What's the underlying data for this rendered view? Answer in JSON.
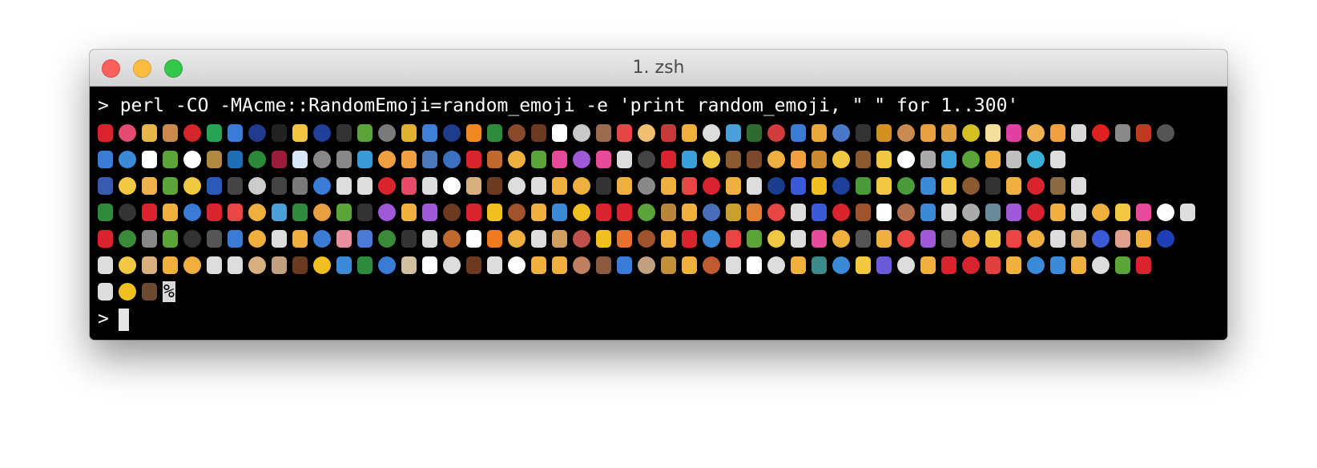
{
  "window": {
    "title": "1. zsh"
  },
  "terminal": {
    "command_line": "> perl -CO -MAcme::RandomEmoji=random_emoji -e 'print random_emoji, \" \" for 1..300'",
    "end_marker": "%",
    "prompt": ">"
  },
  "colors": {
    "background": "#000000",
    "text": "#ffffff",
    "titlebar": "#dcdcdc",
    "close": "#fc605c",
    "minimize": "#fdbc40",
    "maximize": "#34c84a"
  },
  "emoji_rows": [
    [
      "#d9232e",
      "#e34a6f",
      "#e8b64a",
      "#c98a4b",
      "#d6262b",
      "#27a355",
      "#3b7bd8",
      "#203a8c",
      "#222222",
      "#f4c542",
      "#1f3f9b",
      "#333333",
      "#5aa43a",
      "#7a7a7a",
      "#e0b030",
      "#3f7fd8",
      "#1e3c8a",
      "#f08a20",
      "#2e8b3d",
      "#8a4a2a",
      "#6b3a20",
      "#ffffff",
      "#c9c9c9",
      "#9a6b4f",
      "#e54545",
      "#f0c070",
      "#c83a3a",
      "#f0b040",
      "#dddddd",
      "#4aa0d8",
      "#2f6b2f",
      "#d23b3b",
      "#3a7bd5",
      "#e8a83c",
      "#4a78c8",
      "#333333",
      "#d29020",
      "#c88a50",
      "#e8a040",
      "#e0a040",
      "#d4c020",
      "#f2e09a",
      "#e040a0",
      "#f0b050",
      "#f0a040",
      "#d8d8d8",
      "#e02020",
      "#8a8a8a",
      "#c03a20",
      "#555555"
    ],
    [
      "#3a7bd5",
      "#3a8ad8",
      "#ffffff",
      "#5aa43a",
      "#ffffff",
      "#b08a40",
      "#1f6fb8",
      "#2a8a3a",
      "#9a1b3a",
      "#d8e8f8",
      "#888888",
      "#888888",
      "#3a9ad8",
      "#f0a040",
      "#f0a040",
      "#4a78b8",
      "#3a70c0",
      "#d9232e",
      "#c06a30",
      "#f0b040",
      "#5aa43a",
      "#e84a9a",
      "#a05ad8",
      "#e84a9a",
      "#dddddd",
      "#444444",
      "#d9232e",
      "#3aa0d8",
      "#f0c842",
      "#8a5a30",
      "#7a4a2a",
      "#f0b040",
      "#f0a040",
      "#cc8a30",
      "#f0c842",
      "#8a5a30",
      "#f0c842",
      "#ffffff",
      "#aaaaaa",
      "#3aa0d8",
      "#5aa43a",
      "#f0b040",
      "#c0c0c0",
      "#3ab0d8",
      "#dddddd"
    ],
    [
      "#3a5ab0",
      "#f0c842",
      "#f0b050",
      "#5aa43a",
      "#f0c842",
      "#2a5ab8",
      "#444444",
      "#cccccc",
      "#444444",
      "#7a7a7a",
      "#3a7bd5",
      "#dddddd",
      "#dddddd",
      "#d9232e",
      "#e84a6a",
      "#dddddd",
      "#ffffff",
      "#d8b080",
      "#6b3a20",
      "#dddddd",
      "#dddddd",
      "#f0b040",
      "#f0b040",
      "#333333",
      "#f0b040",
      "#888888",
      "#f0b040",
      "#e84545",
      "#d9232e",
      "#f0b040",
      "#dddddd",
      "#1a3c8a",
      "#3a5ad8",
      "#f0c020",
      "#1f3f9b",
      "#4a9a3a",
      "#f0c842",
      "#4a9a3a",
      "#3a8ad8",
      "#f0c842",
      "#8a5a30",
      "#333333",
      "#f0b040",
      "#d9232e",
      "#8a6a40",
      "#dddddd"
    ],
    [
      "#2e8b3d",
      "#333333",
      "#d9232e",
      "#f0b040",
      "#3a7bd5",
      "#d9232e",
      "#e84545",
      "#f0b040",
      "#4aa0d8",
      "#2e8b3d",
      "#e8a040",
      "#5aa43a",
      "#333333",
      "#a05ad8",
      "#f0b040",
      "#a05ad8",
      "#6b3a20",
      "#d9232e",
      "#f0c020",
      "#a0522d",
      "#f0b040",
      "#3a8ad8",
      "#f0c020",
      "#d9232e",
      "#d9232e",
      "#5aa43a",
      "#b8863a",
      "#f0b040",
      "#4a6fb8",
      "#c9a030",
      "#e08030",
      "#e84545",
      "#dddddd",
      "#3a5ad8",
      "#d9232e",
      "#a0522d",
      "#ffffff",
      "#b07050",
      "#3a8ad8",
      "#dddddd",
      "#aaaaaa",
      "#6a8a9a",
      "#a05ad8",
      "#d9232e",
      "#f0b040",
      "#dddddd",
      "#f0b040",
      "#f0c842",
      "#e84a9a",
      "#ffffff",
      "#dddddd"
    ],
    [
      "#d9232e",
      "#3a8a3a",
      "#888888",
      "#5aa43a",
      "#333333",
      "#555555",
      "#3a7bd5",
      "#f0b040",
      "#dddddd",
      "#f0b040",
      "#3a7bd5",
      "#e890a0",
      "#4a7ad8",
      "#3a8a3a",
      "#333333",
      "#dddddd",
      "#c06a30",
      "#ffffff",
      "#f07a20",
      "#f0b040",
      "#dddddd",
      "#d0a060",
      "#c0504a",
      "#f0c020",
      "#e87030",
      "#a0522d",
      "#f0b040",
      "#d9232e",
      "#3a8ad8",
      "#e84545",
      "#5aa43a",
      "#f0c842",
      "#dddddd",
      "#e84a9a",
      "#f0b040",
      "#555555",
      "#f0b040",
      "#e84545",
      "#a05ad8",
      "#555555",
      "#f0b040",
      "#f0c842",
      "#e84545",
      "#f0b040",
      "#dddddd",
      "#d8b080",
      "#3a5ad8",
      "#e0a090",
      "#f0b040",
      "#1f3fb8"
    ],
    [
      "#dddddd",
      "#f0c842",
      "#d8b080",
      "#f0b040",
      "#f0b040",
      "#dddddd",
      "#dddddd",
      "#d8b080",
      "#c0a080",
      "#6b3a20",
      "#f0c020",
      "#3a8ad8",
      "#2e8b3d",
      "#3a7bd5",
      "#d0c0a0",
      "#ffffff",
      "#dddddd",
      "#6b3a20",
      "#dddddd",
      "#ffffff",
      "#f0b040",
      "#f0b040",
      "#c08060",
      "#8a5a40",
      "#3a7ad8",
      "#c0a080",
      "#c0903a",
      "#f0b040",
      "#c05a30",
      "#dddddd",
      "#ffffff",
      "#dddddd",
      "#f0b040",
      "#3a8a8a",
      "#3a8ad8",
      "#f0c842",
      "#6a5ad8",
      "#dddddd",
      "#f0b040",
      "#d9232e",
      "#d9232e",
      "#e04040",
      "#f0b040",
      "#3a8ad8",
      "#3a8ad8",
      "#f0b040",
      "#dddddd",
      "#5aa43a",
      "#d9232e"
    ],
    [
      "#dddddd",
      "#f0c020",
      "#6b4a30"
    ]
  ]
}
